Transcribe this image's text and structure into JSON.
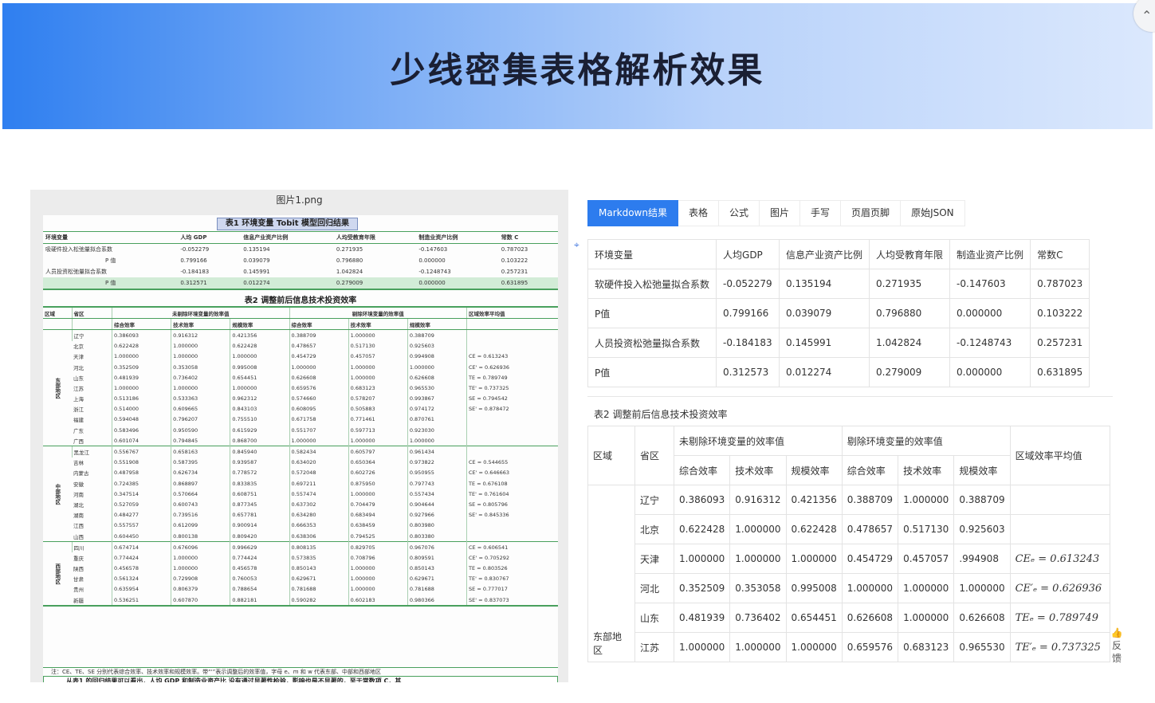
{
  "header": {
    "title": "少线密集表格解析效果",
    "corner_icon": "chevron-up-icon"
  },
  "left": {
    "caption": "图片1.png",
    "table1_title": "表1  环境变量 Tobit 模型回归结果",
    "table1_headers": [
      "环境变量",
      "人均 GDP",
      "信息产业资产比例",
      "人均受教育年限",
      "制造业资产比例",
      "常数 C"
    ],
    "table1_rows": [
      [
        "吸硬件投入松弛量拟合系数",
        "-0.052279",
        "0.135194",
        "0.271935",
        "-0.147603",
        "0.787023"
      ],
      [
        "P 值",
        "0.799166",
        "0.039079",
        "0.796880",
        "0.000000",
        "0.103222"
      ],
      [
        "人员投资松弛量拟合系数",
        "-0.184183",
        "0.145991",
        "1.042824",
        "-0.1248743",
        "0.257231"
      ],
      [
        "P 值",
        "0.312571",
        "0.012274",
        "0.279009",
        "0.000000",
        "0.631895"
      ]
    ],
    "table2_title": "表2  调整前后信息技术投资效率",
    "table2_group_headers": [
      "区域",
      "省区",
      "未剔除环境变量的效率值",
      "剔除环境变量的效率值",
      "区域效率平均值"
    ],
    "table2_sub_headers": [
      "综合效率",
      "技术效率",
      "规模效率",
      "综合效率",
      "技术效率",
      "规模效率"
    ],
    "table2_rows": [
      [
        "东部地区",
        "辽宁",
        "0.386093",
        "0.916312",
        "0.421356",
        "0.388709",
        "1.000000",
        "0.388709",
        ""
      ],
      [
        "",
        "北京",
        "0.622428",
        "1.000000",
        "0.622428",
        "0.478657",
        "0.517130",
        "0.925603",
        ""
      ],
      [
        "",
        "天津",
        "1.000000",
        "1.000000",
        "1.000000",
        "0.454729",
        "0.457057",
        "0.994908",
        "CE = 0.613243"
      ],
      [
        "",
        "河北",
        "0.352509",
        "0.353058",
        "0.995008",
        "1.000000",
        "1.000000",
        "1.000000",
        "CE' = 0.626936"
      ],
      [
        "",
        "山东",
        "0.481939",
        "0.736402",
        "0.654451",
        "0.626608",
        "1.000000",
        "0.626608",
        "TE = 0.789749"
      ],
      [
        "",
        "江苏",
        "1.000000",
        "1.000000",
        "1.000000",
        "0.659576",
        "0.683123",
        "0.965530",
        "TE' = 0.737325"
      ],
      [
        "",
        "上海",
        "0.513186",
        "0.533363",
        "0.962312",
        "0.574660",
        "0.578207",
        "0.993867",
        "SE = 0.794542"
      ],
      [
        "",
        "浙江",
        "0.514000",
        "0.609665",
        "0.843103",
        "0.608095",
        "0.505883",
        "0.974172",
        "SE' = 0.878472"
      ],
      [
        "",
        "福建",
        "0.594048",
        "0.796207",
        "0.755510",
        "0.671758",
        "0.771461",
        "0.870761",
        ""
      ],
      [
        "",
        "广东",
        "0.583496",
        "0.950590",
        "0.615929",
        "0.551707",
        "0.597713",
        "0.923030",
        ""
      ],
      [
        "",
        "广西",
        "0.601074",
        "0.794845",
        "0.868700",
        "1.000000",
        "1.000000",
        "1.000000",
        ""
      ],
      [
        "中部地区",
        "黑龙江",
        "0.556767",
        "0.658163",
        "0.845940",
        "0.582434",
        "0.605797",
        "0.961434",
        ""
      ],
      [
        "",
        "吉林",
        "0.551908",
        "0.587395",
        "0.939587",
        "0.634020",
        "0.650364",
        "0.973822",
        "CE = 0.544655"
      ],
      [
        "",
        "内蒙古",
        "0.487958",
        "0.626734",
        "0.778572",
        "0.572048",
        "0.602726",
        "0.950955",
        "CE' = 0.646663"
      ],
      [
        "",
        "安徽",
        "0.724385",
        "0.868897",
        "0.833835",
        "0.697211",
        "0.875950",
        "0.797743",
        "TE = 0.676108"
      ],
      [
        "",
        "河南",
        "0.347514",
        "0.570664",
        "0.608751",
        "0.557474",
        "1.000000",
        "0.557434",
        "TE' = 0.761604"
      ],
      [
        "",
        "湖北",
        "0.527059",
        "0.600743",
        "0.877345",
        "0.637302",
        "0.704479",
        "0.904644",
        "SE = 0.805796"
      ],
      [
        "",
        "湖南",
        "0.484277",
        "0.739516",
        "0.657781",
        "0.634280",
        "0.683494",
        "0.927966",
        "SE' = 0.845336"
      ],
      [
        "",
        "江西",
        "0.557557",
        "0.612099",
        "0.900914",
        "0.666353",
        "0.638459",
        "0.803980",
        ""
      ],
      [
        "",
        "山西",
        "0.604450",
        "0.800138",
        "0.809420",
        "0.638306",
        "0.794525",
        "0.803380",
        ""
      ],
      [
        "西部地区",
        "四川",
        "0.674714",
        "0.676096",
        "0.996629",
        "0.808135",
        "0.829705",
        "0.967076",
        "CE = 0.606541"
      ],
      [
        "",
        "重庆",
        "0.774424",
        "1.000000",
        "0.774424",
        "0.573835",
        "0.708796",
        "0.809591",
        "CE' = 0.705292"
      ],
      [
        "",
        "陕西",
        "0.456578",
        "1.000000",
        "0.456578",
        "0.850143",
        "1.000000",
        "0.850143",
        "TE = 0.803526"
      ],
      [
        "",
        "甘肃",
        "0.561324",
        "0.729908",
        "0.760053",
        "0.629671",
        "1.000000",
        "0.629671",
        "TE' = 0.830767"
      ],
      [
        "",
        "贵州",
        "0.635954",
        "0.806379",
        "0.788654",
        "0.781688",
        "1.000000",
        "0.781688",
        "SE = 0.777017"
      ],
      [
        "",
        "新疆",
        "0.536251",
        "0.607870",
        "0.882181",
        "0.590282",
        "0.602183",
        "0.980366",
        "SE' = 0.837073"
      ]
    ],
    "note1": "注：CE、TE、SE 分别代表综合效率、技术效率和规模效率。带“'”表示调整后的效率值，字母 e、m 和 w 代表东部、中部和西部地区",
    "note2": "从表1 的回归结果可以看出，人均 GDP 和制造业资产比    没有通过显著性检验，影响也是不显著的，至于常数项 C，其"
  },
  "tabs": [
    "Markdown结果",
    "表格",
    "公式",
    "图片",
    "手写",
    "页眉页脚",
    "原始JSON"
  ],
  "result_table1": {
    "headers": [
      "环境变量",
      "人均GDP",
      "信息产业资产比例",
      "人均受教育年限",
      "制造业资产比例",
      "常数C"
    ],
    "rows": [
      [
        "软硬件投入松弛量拟合系数",
        "-0.052279",
        "0.135194",
        "0.271935",
        "-0.147603",
        "0.787023"
      ],
      [
        "P值",
        "0.799166",
        "0.039079",
        "0.796880",
        "0.000000",
        "0.103222"
      ],
      [
        "人员投资松弛量拟合系数",
        "-0.184183",
        "0.145991",
        "1.042824",
        "-0.1248743",
        "0.257231"
      ],
      [
        "P值",
        "0.312573",
        "0.012274",
        "0.279009",
        "0.000000",
        "0.631895"
      ]
    ]
  },
  "result_table2": {
    "title": "表2 调整前后信息技术投资效率",
    "h_region": "区域",
    "h_province": "省区",
    "h_unadjusted": "未剔除环境变量的效率值",
    "h_adjusted": "剔除环境变量的效率值",
    "h_region_avg": "区域效率平均值",
    "sub_headers": [
      "综合效率",
      "技术效率",
      "规模效率",
      "综合效率",
      "技术效率",
      "规模效率"
    ],
    "region_label": "东部地区",
    "rows": [
      [
        "辽宁",
        "0.386093",
        "0.916312",
        "0.421356",
        "0.388709",
        "1.000000",
        "0.388709",
        ""
      ],
      [
        "北京",
        "0.622428",
        "1.000000",
        "0.622428",
        "0.478657",
        "0.517130",
        "0.925603",
        ""
      ],
      [
        "天津",
        "1.000000",
        "1.000000",
        "1.000000",
        "0.454729",
        "0.457057",
        ".994908",
        "CEₑ = 0.613243"
      ],
      [
        "河北",
        "0.352509",
        "0.353058",
        "0.995008",
        "1.000000",
        "1.000000",
        "1.000000",
        "CE′ₑ = 0.626936"
      ],
      [
        "山东",
        "0.481939",
        "0.736402",
        "0.654451",
        "0.626608",
        "1.000000",
        "0.626608",
        "TEₑ = 0.789749"
      ],
      [
        "江苏",
        "1.000000",
        "1.000000",
        "1.000000",
        "0.659576",
        "0.683123",
        "0.965530",
        "TE′ₑ = 0.737325"
      ]
    ]
  },
  "side_tools": {
    "thumb_icon": "thumbs-up-icon",
    "feedback_label": "反馈"
  }
}
